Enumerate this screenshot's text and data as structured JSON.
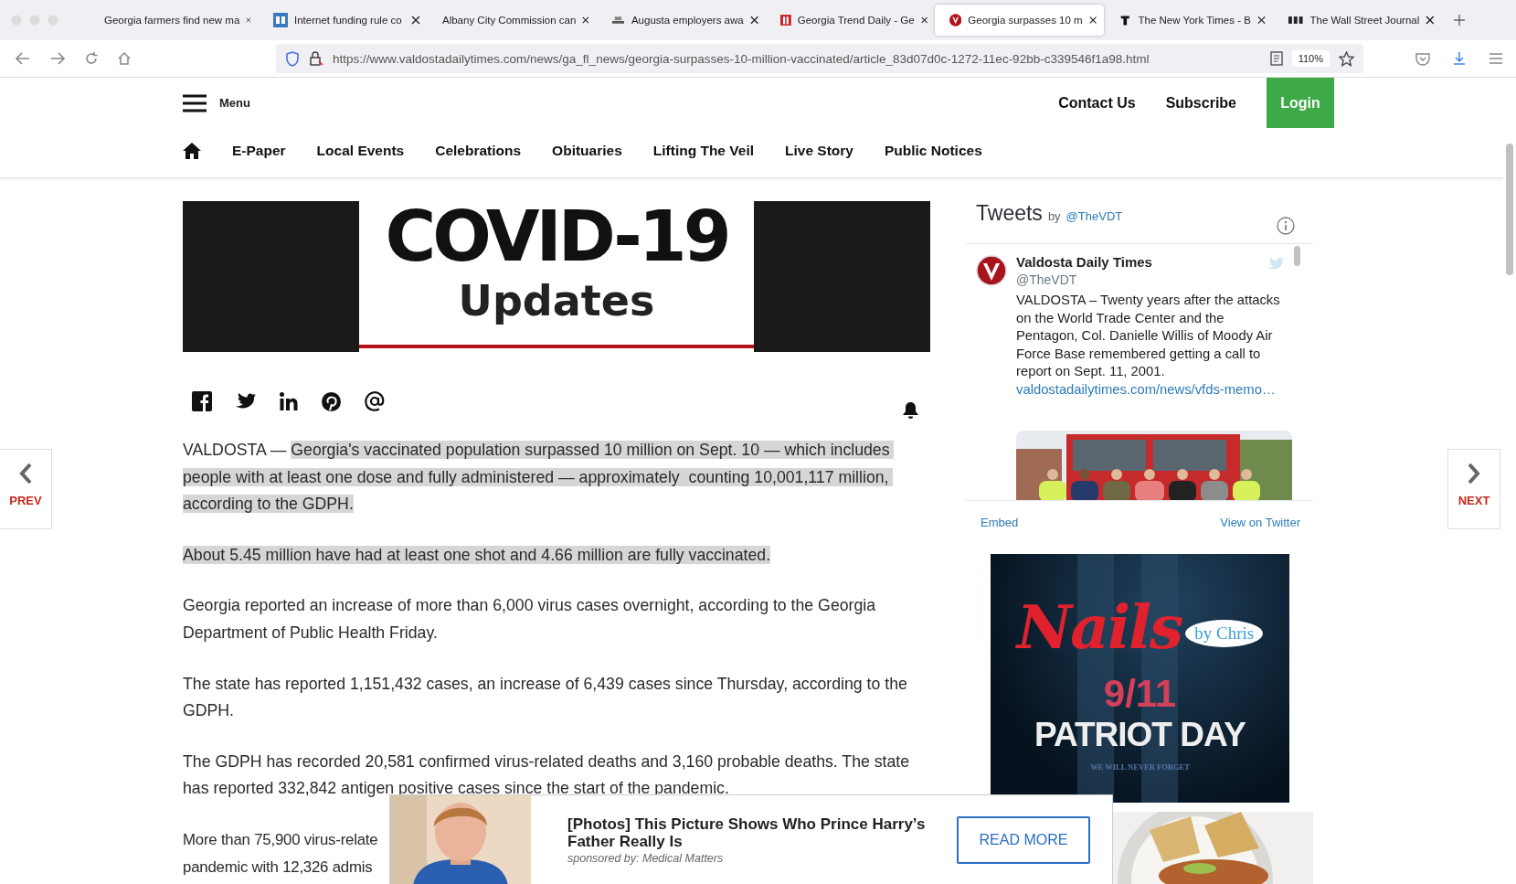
{
  "browser": {
    "tabs": [
      {
        "title": "Georgia farmers find new ma",
        "selected": false
      },
      {
        "title": "Internet funding rule co",
        "selected": false
      },
      {
        "title": "Albany City Commission can",
        "selected": false
      },
      {
        "title": "Augusta employers awa",
        "selected": false
      },
      {
        "title": "Georgia Trend Daily - Ge",
        "selected": false
      },
      {
        "title": "Georgia surpasses 10 m",
        "selected": true
      },
      {
        "title": "The New York Times - B",
        "selected": false
      },
      {
        "title": "The Wall Street Journal",
        "selected": false
      }
    ],
    "url": "https://www.valdostadailytimes.com/news/ga_fl_news/georgia-surpasses-10-million-vaccinated/article_83d07d0c-1272-11ec-92bb-c339546f1a98.html",
    "zoom": "110%"
  },
  "header": {
    "menu": "Menu",
    "links": [
      "Contact Us",
      "Subscribe"
    ],
    "login": "Login",
    "nav": [
      "E-Paper",
      "Local Events",
      "Celebrations",
      "Obituaries",
      "Lifting The Veil",
      "Live Story",
      "Public Notices"
    ]
  },
  "banner": {
    "title": "COVID-19",
    "subtitle": "Updates"
  },
  "article": {
    "paragraphs": [
      {
        "lead": "VALDOSTA — ",
        "text": "Georgia's vaccinated population surpassed 10 million on Sept. 10 — which includes people with at least one dose and fully administered — approximately  counting 10,001,117 million, according to the GDPH.",
        "highlighted": true
      },
      {
        "text": "About 5.45 million have had at least one shot and 4.66 million are fully vaccinated.",
        "highlighted": true
      },
      {
        "text": "Georgia reported an increase of more than 6,000 virus cases overnight, according to the Georgia Department of Public Health Friday.",
        "highlighted": false
      },
      {
        "text": "The state has reported 1,151,432 cases, an increase of 6,439 cases since Thursday, according to the GDPH.",
        "highlighted": false
      },
      {
        "text": "The GDPH has recorded 20,581 confirmed virus-related deaths and 3,160 probable deaths. The state has reported 332,842 antigen positive cases since the start of the pandemic.",
        "highlighted": false
      },
      {
        "lines": [
          "More than 75,900 virus-relate",
          "pandemic with 12,326 admis"
        ],
        "highlighted": false
      }
    ]
  },
  "pager": {
    "prev": "PREV",
    "next": "NEXT"
  },
  "tweets": {
    "title": "Tweets",
    "by": "by",
    "handle": "@TheVDT",
    "tweet": {
      "name": "Valdosta Daily Times",
      "handle": "@TheVDT",
      "text": "VALDOSTA – Twenty years after the attacks on the World Trade Center and the Pentagon, Col. Danielle Willis of Moody Air Force Base remembered getting a call to report on Sept. 11, 2001.",
      "link": "valdostadailytimes.com/news/vfds-memo…"
    },
    "embed": "Embed",
    "view": "View on Twitter"
  },
  "side_ad": {
    "brand": "Nails",
    "brand_sub": "by Chris",
    "date": "9/11",
    "headline": "PATRIOT DAY",
    "tagline": "WE WILL NEVER FORGET"
  },
  "bottom_ad": {
    "headline": "[Photos] This Picture Shows Who Prince Harry’s Father Really Is",
    "sponsor": "sponsored by: Medical Matters",
    "button": "READ MORE"
  }
}
